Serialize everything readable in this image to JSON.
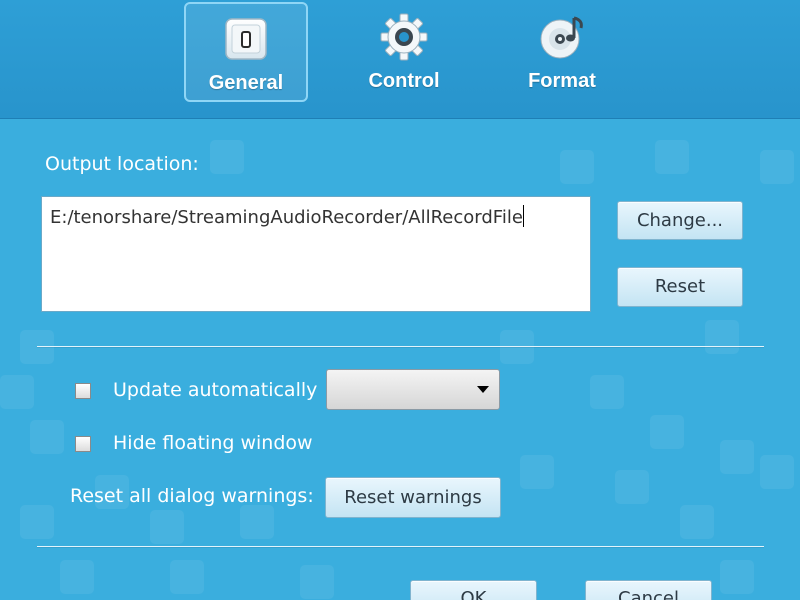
{
  "tabs": [
    {
      "label": "General",
      "icon": "general-switch-icon",
      "active": true
    },
    {
      "label": "Control",
      "icon": "gear-icon",
      "active": false
    },
    {
      "label": "Format",
      "icon": "music-disc-icon",
      "active": false
    }
  ],
  "output": {
    "label": "Output location:",
    "path": "E:/tenorshare/StreamingAudioRecorder/AllRecordFile",
    "change_label": "Change...",
    "reset_label": "Reset"
  },
  "options": {
    "update_auto_label": "Update automatically",
    "update_auto_checked": false,
    "update_dropdown_value": "",
    "hide_floating_label": "Hide floating window",
    "hide_floating_checked": false,
    "reset_warnings_label": "Reset all dialog warnings:",
    "reset_warnings_button": "Reset warnings"
  },
  "footer": {
    "ok_label": "OK",
    "cancel_label": "Cancel"
  },
  "colors": {
    "background": "#3aaede",
    "header": "#2e9fd6",
    "button_face": "#d6eef9"
  }
}
